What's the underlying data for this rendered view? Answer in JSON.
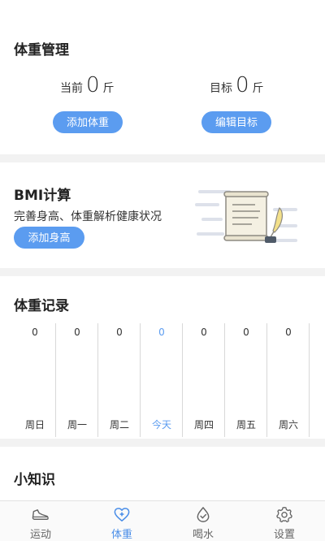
{
  "weight": {
    "title": "体重管理",
    "current_label": "当前",
    "current_value": "0",
    "current_unit": "斤",
    "target_label": "目标",
    "target_value": "0",
    "target_unit": "斤",
    "add_button": "添加体重",
    "edit_button": "编辑目标"
  },
  "bmi": {
    "title": "BMI计算",
    "description": "完善身高、体重解析健康状况",
    "add_button": "添加身高",
    "illustration_icon": "document-quill-icon"
  },
  "records": {
    "title": "体重记录",
    "days": [
      {
        "label": "周日",
        "value": "0"
      },
      {
        "label": "周一",
        "value": "0"
      },
      {
        "label": "周二",
        "value": "0"
      },
      {
        "label": "今天",
        "value": "0",
        "today": true
      },
      {
        "label": "周四",
        "value": "0"
      },
      {
        "label": "周五",
        "value": "0"
      },
      {
        "label": "周六",
        "value": "0"
      }
    ],
    "today_color": "#5b9cf0"
  },
  "tips": {
    "title": "小知识"
  },
  "tabbar": {
    "items": [
      {
        "label": "运动",
        "icon": "sneaker-icon"
      },
      {
        "label": "体重",
        "icon": "heart-plus-icon",
        "active": true
      },
      {
        "label": "喝水",
        "icon": "water-drop-check-icon"
      },
      {
        "label": "设置",
        "icon": "gear-icon"
      }
    ],
    "active_color": "#4a8ee8"
  },
  "colors": {
    "accent": "#5b9cf0"
  }
}
